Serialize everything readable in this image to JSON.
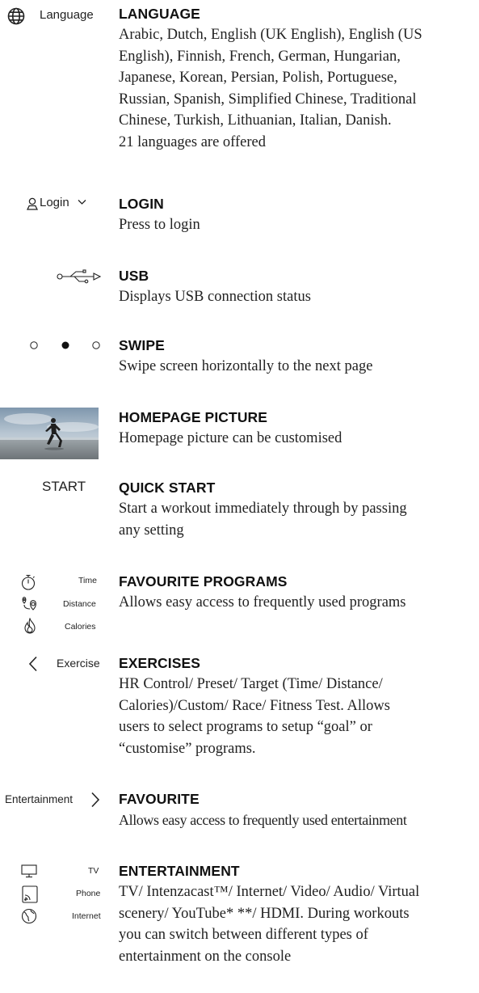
{
  "language": {
    "icon_label": "Language",
    "title": "LANGUAGE",
    "lines": [
      "Arabic, Dutch, English (UK English), English (US",
      "English), Finnish, French, German, Hungarian,",
      "Japanese, Korean, Persian, Polish, Portuguese,",
      "Russian, Spanish, Simplified Chinese, Traditional",
      "Chinese, Turkish, Lithuanian, Italian, Danish.",
      "21 languages are offered"
    ]
  },
  "login": {
    "icon_label": "Login",
    "title": "LOGIN",
    "lines": [
      "Press to login"
    ]
  },
  "usb": {
    "title": "USB",
    "lines": [
      "Displays USB connection status"
    ]
  },
  "swipe": {
    "title": "SWIPE",
    "lines": [
      "Swipe screen horizontally to the next page"
    ]
  },
  "homepage_picture": {
    "title": "HOMEPAGE PICTURE",
    "lines": [
      "Homepage picture can be customised"
    ]
  },
  "quick_start": {
    "icon_label": "START",
    "title": "QUICK START",
    "lines": [
      "Start a workout immediately through by passing",
      "any setting"
    ]
  },
  "favourite_programs": {
    "icon_labels": [
      "Time",
      "Distance",
      "Calories"
    ],
    "title": "FAVOURITE PROGRAMS",
    "lines": [
      "Allows easy access to frequently used programs"
    ]
  },
  "exercises": {
    "icon_label": "Exercise",
    "title": "EXERCISES",
    "lines": [
      "HR Control/ Preset/ Target (Time/ Distance/",
      "Calories)/Custom/ Race/ Fitness Test.  Allows",
      "users to select programs to setup “goal” or",
      "“customise” programs."
    ]
  },
  "favourite": {
    "icon_label": "Entertainment",
    "title": "FAVOURITE",
    "lines": [
      "Allows easy access to frequently used entertainment"
    ]
  },
  "entertainment": {
    "icon_labels": [
      "TV",
      "Phone",
      "Internet"
    ],
    "title": "ENTERTAINMENT",
    "lines": [
      "TV/ Intenzacast™/ Internet/ Video/ Audio/ Virtual",
      "scenery/ YouTube* **/ HDMI.  During workouts",
      "you can switch between different types of",
      "entertainment on the console"
    ]
  }
}
